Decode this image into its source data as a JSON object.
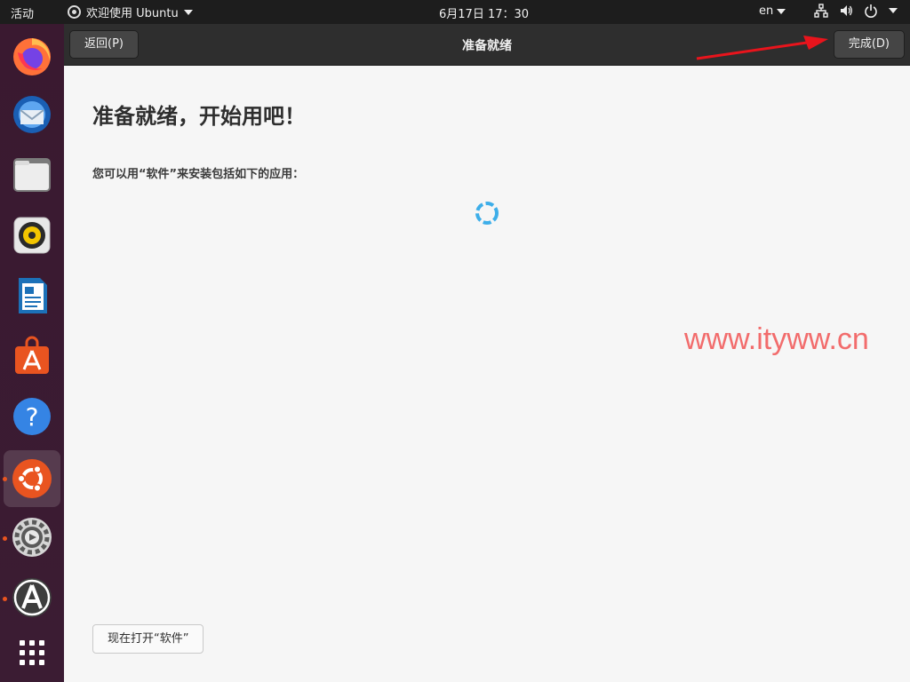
{
  "topbar": {
    "activities": "活动",
    "app_menu": "欢迎使用 Ubuntu",
    "clock": "6月17日  17：30",
    "language": "en"
  },
  "dock": {
    "items": [
      {
        "name": "Firefox",
        "icon": "firefox-icon"
      },
      {
        "name": "Thunderbird",
        "icon": "thunderbird-icon"
      },
      {
        "name": "Files",
        "icon": "files-icon"
      },
      {
        "name": "Rhythmbox",
        "icon": "rhythmbox-icon"
      },
      {
        "name": "LibreOffice Writer",
        "icon": "writer-icon"
      },
      {
        "name": "Ubuntu Software",
        "icon": "software-icon"
      },
      {
        "name": "Help",
        "icon": "help-icon",
        "glyph": "?"
      },
      {
        "name": "Welcome to Ubuntu",
        "icon": "ubuntu-icon"
      },
      {
        "name": "Settings",
        "icon": "settings-icon"
      },
      {
        "name": "Software Updater",
        "icon": "updater-icon"
      },
      {
        "name": "Show Applications",
        "icon": "app-grid-icon"
      }
    ]
  },
  "window": {
    "back_label": "返回(P)",
    "title": "准备就绪",
    "done_label": "完成(D)",
    "heading": "准备就绪，开始用吧！",
    "subtext": "您可以用“软件”来安装包括如下的应用：",
    "open_software_label": "现在打开“软件”"
  },
  "watermark": "www.ityww.cn",
  "colors": {
    "accent": "#e95420",
    "topbar": "#1d1d1d",
    "header": "#2e2e2e",
    "spinner": "#3daee9",
    "watermark": "#f26c6c",
    "annotation_arrow": "#e8141c"
  }
}
